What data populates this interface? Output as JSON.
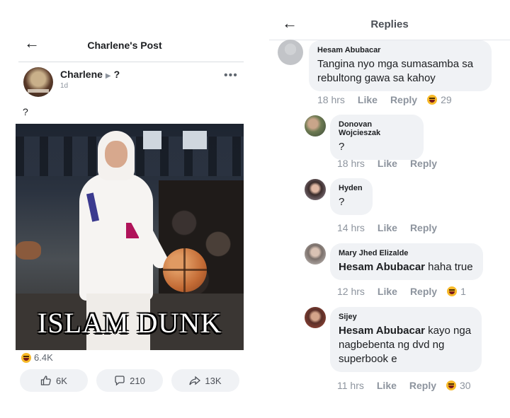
{
  "left": {
    "header_title": "Charlene's Post",
    "author": {
      "name": "Charlene",
      "target": "?",
      "time": "1d"
    },
    "post_text": "?",
    "image_caption": "ISLAM DUNK",
    "reactions_count": "6.4K",
    "actions": {
      "like": "6K",
      "comment": "210",
      "share": "13K"
    }
  },
  "right": {
    "title": "Replies",
    "comments": [
      {
        "name": "Hesam Abubacar",
        "mention": "",
        "text": "Tangina nyo mga sumasamba sa rebultong gawa sa kahoy",
        "time": "18 hrs",
        "like": "Like",
        "reply": "Reply",
        "reaction_count": "29"
      },
      {
        "name": "Donovan Wojcieszak",
        "mention": "",
        "text": "?",
        "time": "18 hrs",
        "like": "Like",
        "reply": "Reply",
        "reaction_count": ""
      },
      {
        "name": "Hyden",
        "mention": "",
        "text": "?",
        "time": "14 hrs",
        "like": "Like",
        "reply": "Reply",
        "reaction_count": ""
      },
      {
        "name": "Mary Jhed Elizalde",
        "mention": "Hesam Abubacar",
        "text": " haha true",
        "time": "12 hrs",
        "like": "Like",
        "reply": "Reply",
        "reaction_count": "1"
      },
      {
        "name": "Sijey",
        "mention": "Hesam Abubacar",
        "text": " kayo nga nagbebenta ng dvd ng superbook e",
        "time": "11 hrs",
        "like": "Like",
        "reply": "Reply",
        "reaction_count": "30"
      }
    ]
  },
  "colors": {
    "bubble": "#f0f2f5",
    "meta_text": "#8d949e",
    "haha_emoji": "#f7b928"
  },
  "icons": [
    "back-arrow-icon",
    "more-icon",
    "thumbs-up-icon",
    "comment-icon",
    "share-icon",
    "haha-emoji-icon"
  ]
}
